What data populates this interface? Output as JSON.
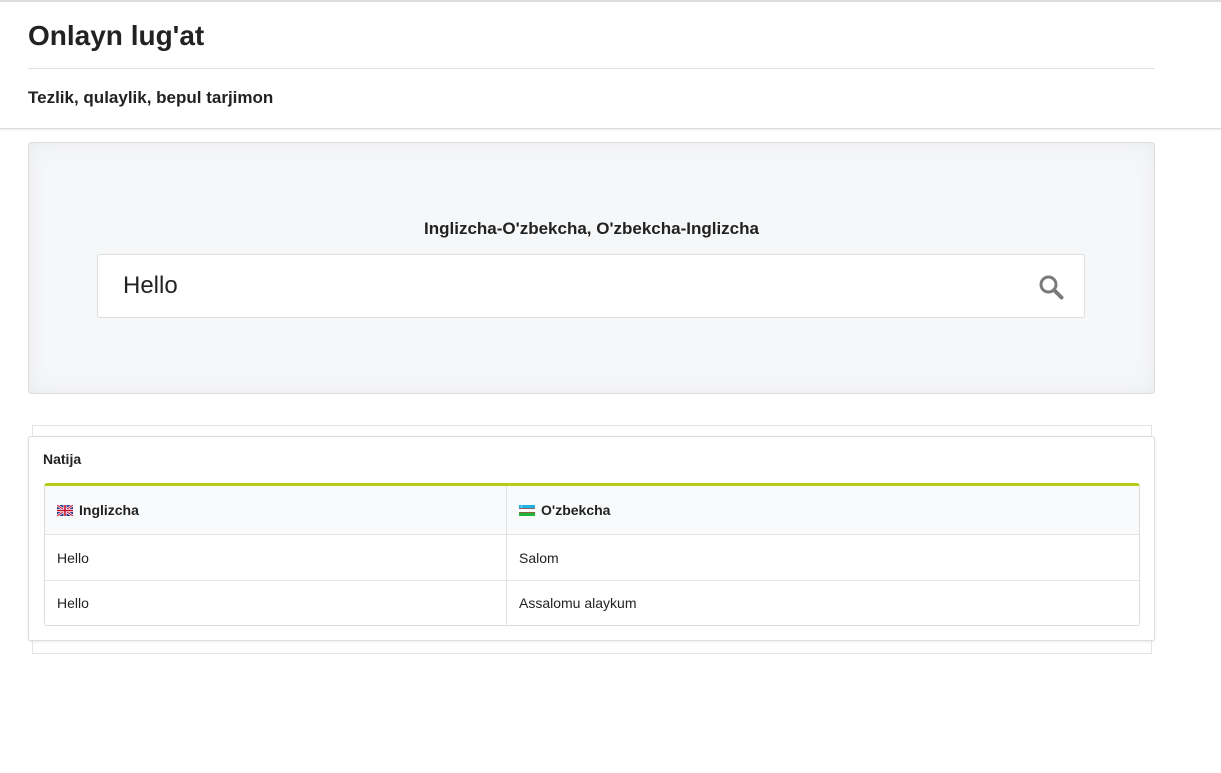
{
  "header": {
    "title": "Onlayn lug'at",
    "tagline": "Tezlik, qulaylik, bepul tarjimon"
  },
  "search": {
    "heading": "Inglizcha-O'zbekcha, O'zbekcha-Inglizcha",
    "value": "Hello",
    "icon": "search-icon"
  },
  "result": {
    "title": "Natija",
    "columns": [
      {
        "label": "Inglizcha",
        "icon": "uk-flag-icon"
      },
      {
        "label": "O'zbekcha",
        "icon": "uz-flag-icon"
      }
    ],
    "rows": [
      {
        "en": "Hello",
        "uz": "Salom"
      },
      {
        "en": "Hello",
        "uz": "Assalomu alaykum"
      }
    ]
  },
  "colors": {
    "accent": "#b5cc18",
    "panel_bg": "#f6f7f8"
  }
}
